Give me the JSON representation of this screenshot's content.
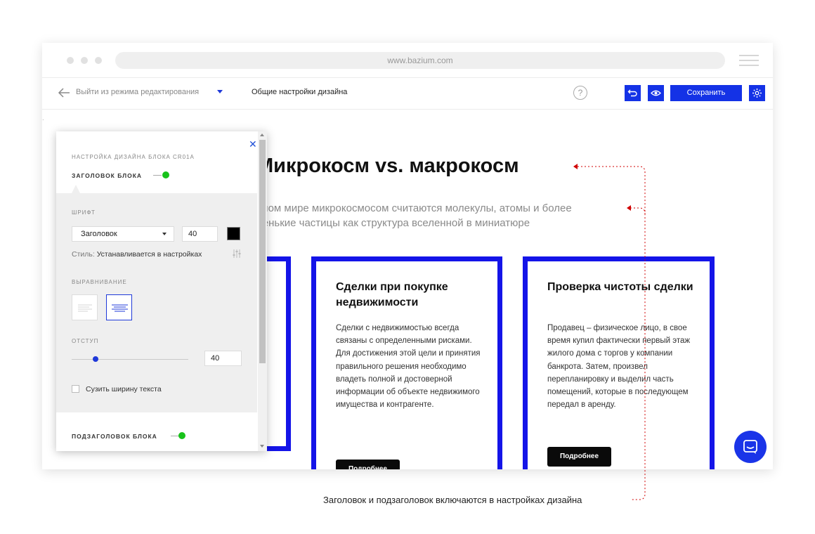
{
  "browser": {
    "url": "www.bazium.com"
  },
  "editbar": {
    "exit_label": "Выйти из режима редактирования",
    "general_settings": "Общие настройки дизайна",
    "help_label": "?",
    "save_label": "Сохранить"
  },
  "page": {
    "title": "Микрокосм vs. макрокосм",
    "subtitle_line1": "нном мире микрокосмосом считаются молекулы, атомы и более",
    "subtitle_line2": "ленькие частицы как структура вселенной в миниатюре",
    "cards": [
      {
        "title": "Сделки при покупке недвижимости",
        "text": "Сделки с недвижимостью всегда связаны с определенными рисками. Для достижения этой цели и принятия правильного решения необходимо владеть полной и достоверной информации об объекте недвижимого имущества и контрагенте.",
        "button": "Подробнее"
      },
      {
        "title": "Проверка чистоты сделки",
        "text": "Продавец – физическое лицо, в свое время купил фактически первый этаж жилого дома с торгов у компании банкрота. Затем, произвел перепланировку и выделил часть помещений, которые в последующем передал в аренду.",
        "button": "Подробнее"
      }
    ]
  },
  "panel": {
    "header_label": "Настройка дизайна блока CR01A",
    "heading_section": "Заголовок блока",
    "font_label": "Шрифт",
    "font_select_value": "Заголовок",
    "font_size_value": "40",
    "font_color": "#000000",
    "style_prefix": "Стиль:",
    "style_value": "Устанавливается в настройках",
    "align_label": "Выравнивание",
    "align_selected": "center",
    "indent_label": "Отступ",
    "indent_value": "40",
    "indent_slider_fraction": 0.2,
    "narrow_text_label": "Сузить ширину текста",
    "narrow_text_checked": false,
    "subheading_section": "Подзаголовок блока",
    "toggles_on": true
  },
  "annotation": {
    "note": "Заголовок и подзаголовок включаются в настройках дизайна"
  },
  "colors": {
    "accent": "#1432e6",
    "card_border": "#1414e8",
    "toggle_on": "#18c21a",
    "annotation_red": "#d00000"
  },
  "icons": [
    "back-arrow-icon",
    "caret-down-icon",
    "help-icon",
    "undo-icon",
    "eye-icon",
    "gear-icon",
    "close-icon",
    "sliders-icon",
    "align-left-icon",
    "align-center-icon",
    "chat-icon",
    "menu-icon"
  ]
}
